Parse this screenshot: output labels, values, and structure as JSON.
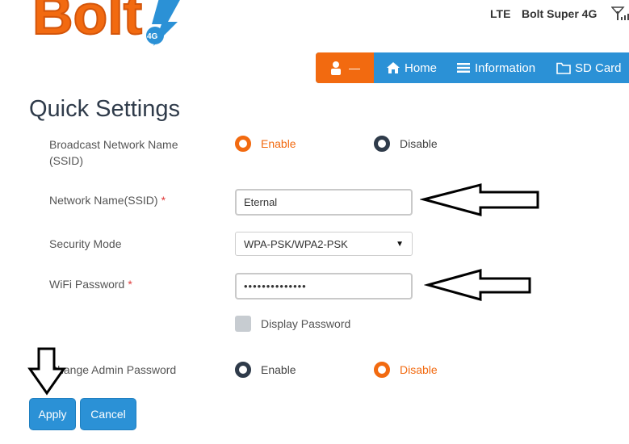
{
  "brand": {
    "logo_text": "Bolt",
    "badge_text": "4G"
  },
  "status": {
    "network_type": "LTE",
    "network_name": "Bolt Super 4G"
  },
  "nav": {
    "user_label": "—",
    "home": "Home",
    "information": "Information",
    "sd_card": "SD Card"
  },
  "page": {
    "title": "Quick Settings"
  },
  "form": {
    "broadcast": {
      "label_line1": "Broadcast Network Name",
      "label_line2": "(SSID)",
      "enable": "Enable",
      "disable": "Disable",
      "selected": "enable"
    },
    "ssid": {
      "label": "Network Name(SSID)",
      "required_mark": "*",
      "value": "Eternal"
    },
    "security": {
      "label": "Security Mode",
      "value": "WPA-PSK/WPA2-PSK",
      "arrow": "▼"
    },
    "password": {
      "label": "WiFi Password",
      "required_mark": "*",
      "value": "••••••••••••••"
    },
    "display_password": {
      "label": "Display Password",
      "checked": false
    },
    "admin_password": {
      "label": "Change Admin Password",
      "enable": "Enable",
      "disable": "Disable",
      "selected": "disable"
    }
  },
  "buttons": {
    "apply": "Apply",
    "cancel": "Cancel"
  },
  "colors": {
    "accent_orange": "#f26a10",
    "nav_blue": "#2b91d6",
    "title_dark": "#2f3b4a",
    "required_red": "#e03a3a"
  }
}
